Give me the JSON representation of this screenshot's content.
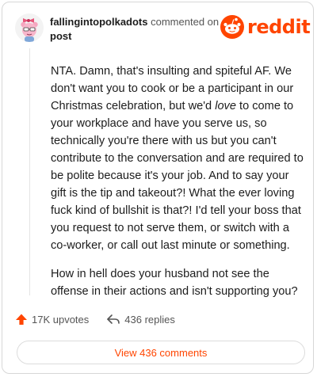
{
  "header": {
    "username": "fallingintopolkadots",
    "commented_text": "commented on",
    "post_link": "post"
  },
  "brand": {
    "wordmark": "reddit",
    "color": "#ff4500"
  },
  "comment": {
    "p1_a": "NTA. Damn, that's insulting and spiteful AF. We don't want you to cook or be a participant in our Christmas celebration, but we'd ",
    "p1_em": "love",
    "p1_b": " to come to your workplace and have you serve us, so technically you're there with us but you can't contribute to the conversation and are required to be polite because it's your job. And to say your gift is the tip and takeout?! What the ever loving fuck kind of bullshit is that?! I'd tell your boss that you request to not serve them, or switch with a co-worker, or call out last minute or something.",
    "p2": "How in hell does your husband not see the offense in their actions and isn't supporting you?"
  },
  "actions": {
    "upvotes": "17K upvotes",
    "upvote_icon": "arrow-up-icon",
    "replies": "436 replies",
    "reply_icon": "reply-arrow-icon"
  },
  "view_button": "View 436 comments"
}
